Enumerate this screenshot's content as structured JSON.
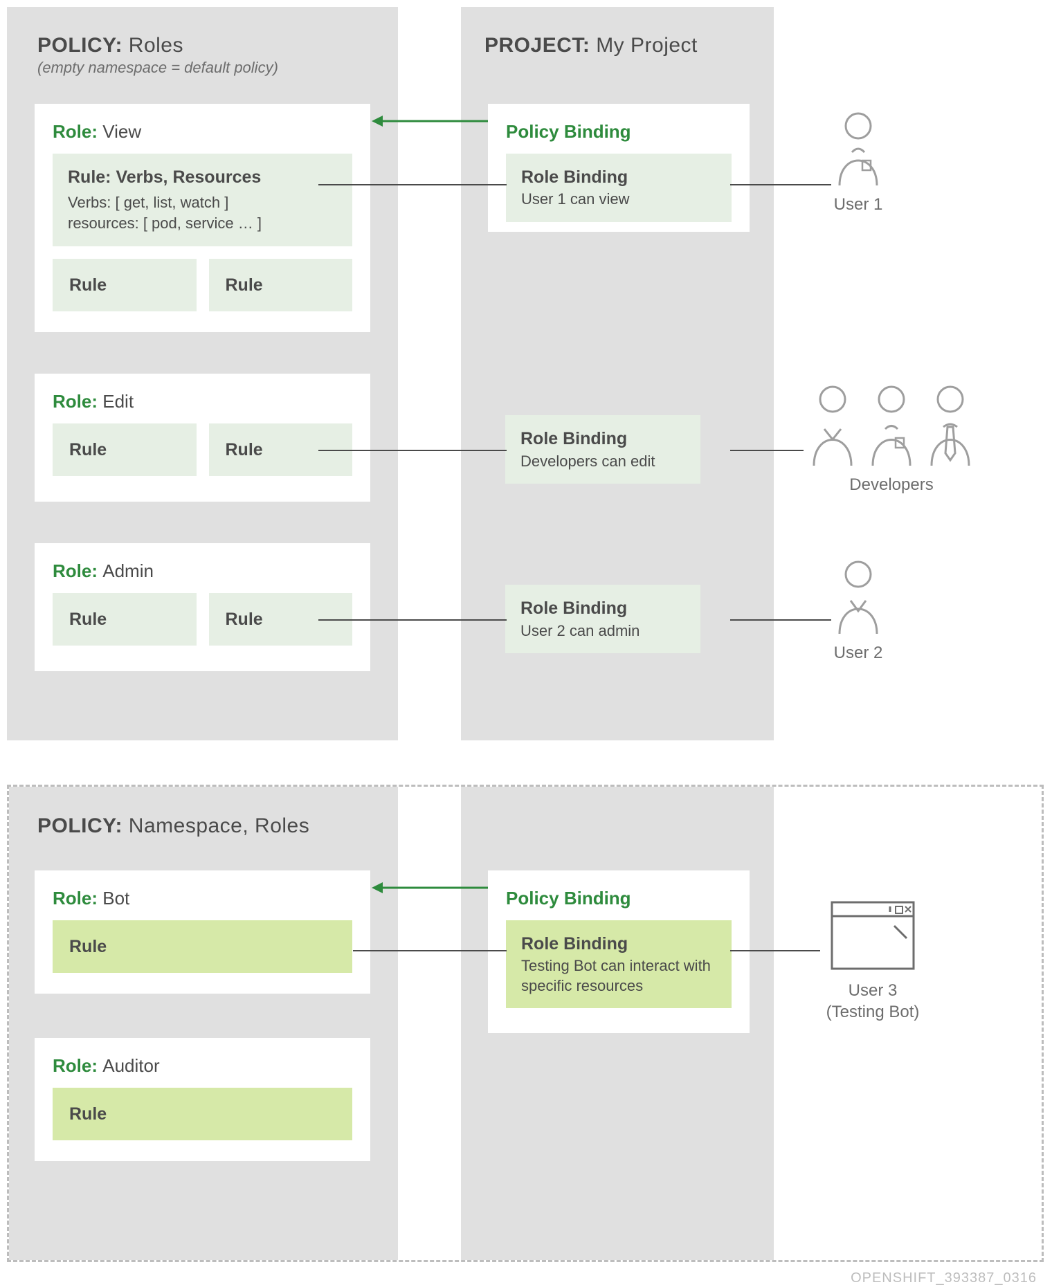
{
  "upper": {
    "policy_title_strong": "POLICY:",
    "policy_title_rest": " Roles",
    "policy_subtitle": "(empty namespace = default policy)",
    "project_title_strong": "PROJECT:",
    "project_title_rest": " My Project",
    "roles": {
      "view": {
        "label": "Role:",
        "name": "View",
        "rule1_head": "Rule: Verbs, Resources",
        "rule1_verbs": "Verbs: [ get, list, watch ]",
        "rule1_res": "resources: [ pod, service … ]",
        "rule_small_a": "Rule",
        "rule_small_b": "Rule"
      },
      "edit": {
        "label": "Role:",
        "name": "Edit",
        "rule_small_a": "Rule",
        "rule_small_b": "Rule"
      },
      "admin": {
        "label": "Role:",
        "name": "Admin",
        "rule_small_a": "Rule",
        "rule_small_b": "Rule"
      }
    },
    "bindings": {
      "pb_title": "Policy Binding",
      "rb1": {
        "head": "Role Binding",
        "body": "User 1 can view"
      },
      "rb2": {
        "head": "Role Binding",
        "body": "Developers can edit"
      },
      "rb3": {
        "head": "Role Binding",
        "body": "User 2 can admin"
      }
    },
    "users": {
      "u1": "User 1",
      "devs": "Developers",
      "u2": "User 2"
    }
  },
  "lower": {
    "policy_title_strong": "POLICY:",
    "policy_title_rest": " Namespace, Roles",
    "roles": {
      "bot": {
        "label": "Role:",
        "name": "Bot",
        "rule": "Rule"
      },
      "auditor": {
        "label": "Role:",
        "name": "Auditor",
        "rule": "Rule"
      }
    },
    "bindings": {
      "pb_title": "Policy Binding",
      "rb": {
        "head": "Role Binding",
        "body": "Testing Bot can interact with specific resources"
      }
    },
    "users": {
      "u3_line1": "User 3",
      "u3_line2": "(Testing Bot)"
    }
  },
  "footer_id": "OPENSHIFT_393387_0316"
}
